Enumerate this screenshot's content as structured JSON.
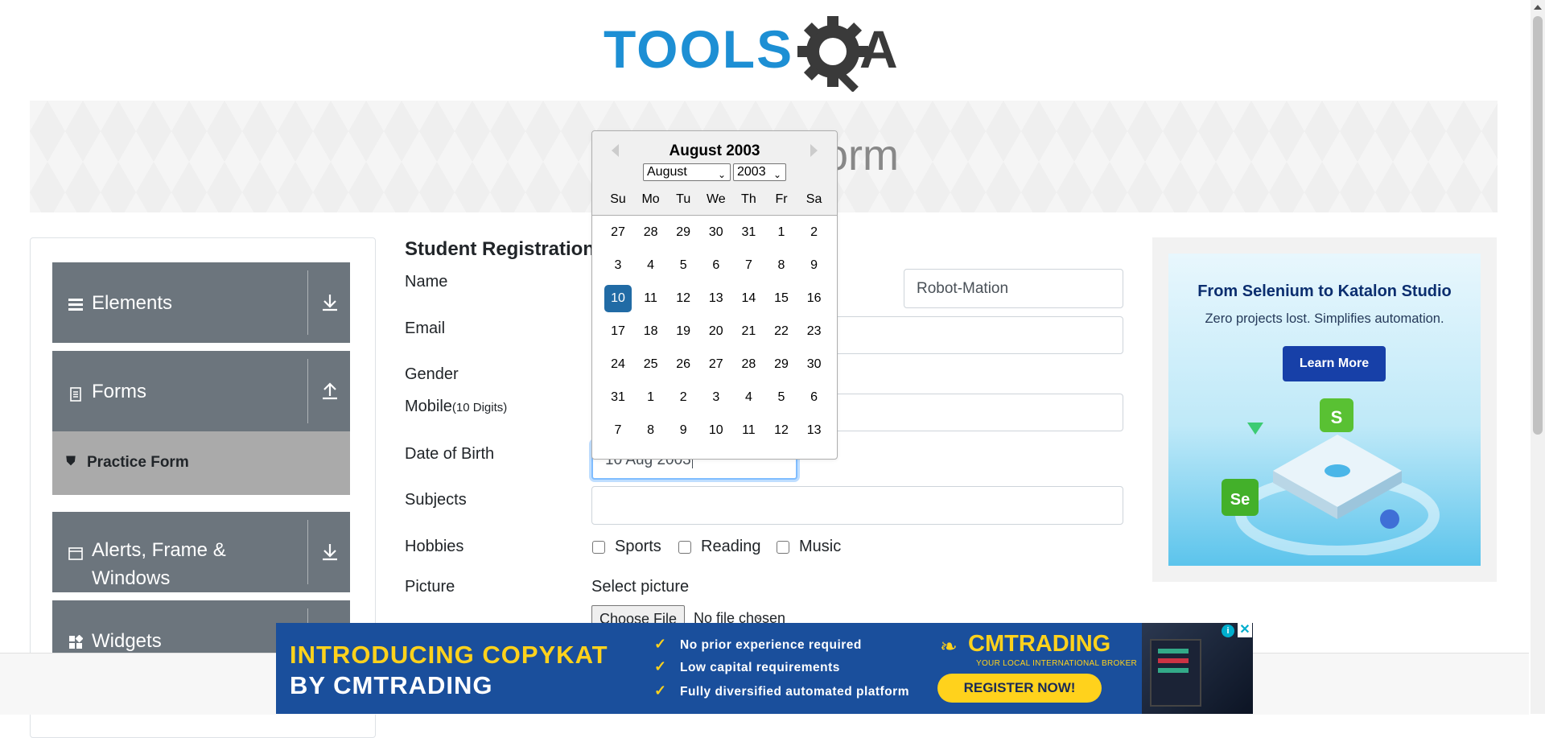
{
  "header": {
    "logo_text_a": "TOOLS",
    "logo_text_b": "QA"
  },
  "banner": {
    "title": "Practice Form"
  },
  "sidebar": {
    "groups": [
      {
        "label": "Elements",
        "icon": "hamburger-icon",
        "arrow": "download-arrow-icon"
      },
      {
        "label": "Forms",
        "icon": "document-icon",
        "arrow": "upload-arrow-icon"
      },
      {
        "label_line1": "Alerts, Frame &",
        "label_line2": "Windows",
        "icon": "window-icon",
        "arrow": "download-arrow-icon"
      },
      {
        "label": "Widgets",
        "icon": "widgets-icon"
      }
    ],
    "active_item": "Practice Form"
  },
  "form": {
    "heading": "Student Registration Form",
    "name_label": "Name",
    "last_name_value": "Robot-Mation",
    "email_label": "Email",
    "gender_label": "Gender",
    "mobile_label": "Mobile",
    "mobile_hint": "(10 Digits)",
    "dob_label": "Date of Birth",
    "dob_value": "10 Aug 2003",
    "subjects_label": "Subjects",
    "hobbies_label": "Hobbies",
    "hobbies": [
      "Sports",
      "Reading",
      "Music"
    ],
    "picture_label": "Picture",
    "picture_caption": "Select picture",
    "choose_file_label": "Choose File",
    "no_file_text": "No file chosen"
  },
  "datepicker": {
    "title": "August 2003",
    "month_select": "August",
    "year_select": "2003",
    "weekdays": [
      "Su",
      "Mo",
      "Tu",
      "We",
      "Th",
      "Fr",
      "Sa"
    ],
    "weeks": [
      [
        "27",
        "28",
        "29",
        "30",
        "31",
        "1",
        "2"
      ],
      [
        "3",
        "4",
        "5",
        "6",
        "7",
        "8",
        "9"
      ],
      [
        "10",
        "11",
        "12",
        "13",
        "14",
        "15",
        "16"
      ],
      [
        "17",
        "18",
        "19",
        "20",
        "21",
        "22",
        "23"
      ],
      [
        "24",
        "25",
        "26",
        "27",
        "28",
        "29",
        "30"
      ],
      [
        "31",
        "1",
        "2",
        "3",
        "4",
        "5",
        "6"
      ],
      [
        "7",
        "8",
        "9",
        "10",
        "11",
        "12",
        "13"
      ]
    ],
    "selected_day": "10",
    "accent_color": "#216ba5"
  },
  "ad_right": {
    "title": "From Selenium to Katalon Studio",
    "subtitle": "Zero projects lost. Simplifies automation.",
    "button": "Learn More",
    "badge_se": "Se",
    "badge_s": "S"
  },
  "ad_bottom": {
    "line1": "INTRODUCING COPYKAT",
    "line2": "BY CMTRADING",
    "bullets": [
      "No prior experience required",
      "Low capital requirements",
      "Fully diversified automated platform"
    ],
    "brand": "CMTRADING",
    "tagline": "YOUR LOCAL INTERNATIONAL BROKER",
    "cta": "REGISTER NOW!"
  }
}
